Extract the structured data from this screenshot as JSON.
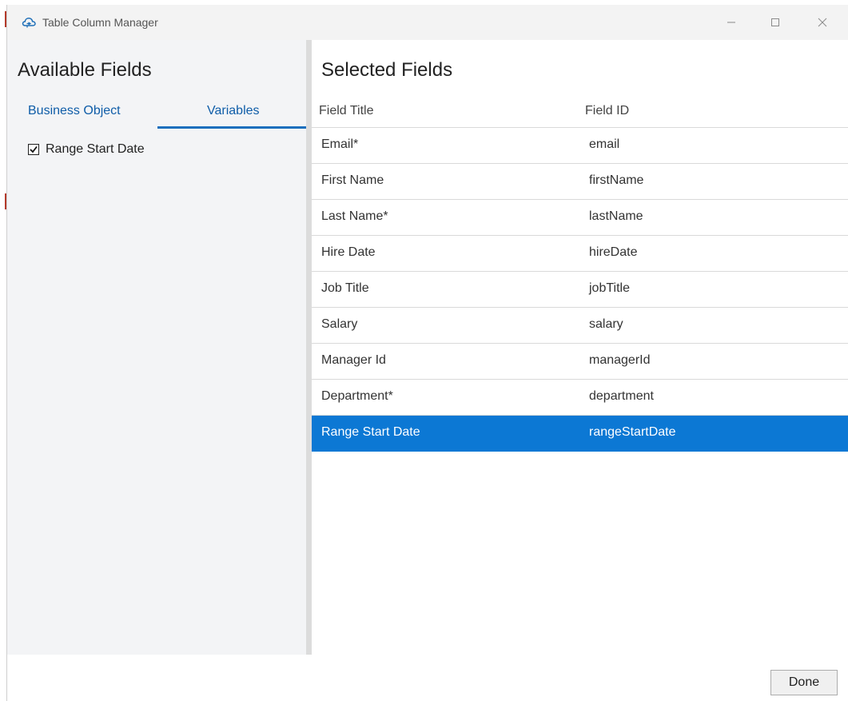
{
  "window": {
    "title": "Table Column Manager",
    "icon": "cloud-logo-icon",
    "controls": {
      "minimize": "minimize-icon",
      "maximize": "maximize-icon",
      "close": "close-icon"
    }
  },
  "available_fields": {
    "heading": "Available Fields",
    "tabs": [
      {
        "label": "Business Object",
        "active": false
      },
      {
        "label": "Variables",
        "active": true
      }
    ],
    "items": [
      {
        "label": "Range Start Date",
        "checked": true
      }
    ]
  },
  "selected_fields": {
    "heading": "Selected Fields",
    "columns": [
      "Field Title",
      "Field ID"
    ],
    "rows": [
      {
        "title": "Email*",
        "id": "email",
        "selected": false
      },
      {
        "title": "First Name",
        "id": "firstName",
        "selected": false
      },
      {
        "title": "Last Name*",
        "id": "lastName",
        "selected": false
      },
      {
        "title": "Hire Date",
        "id": "hireDate",
        "selected": false
      },
      {
        "title": "Job Title",
        "id": "jobTitle",
        "selected": false
      },
      {
        "title": "Salary",
        "id": "salary",
        "selected": false
      },
      {
        "title": "Manager Id",
        "id": "managerId",
        "selected": false
      },
      {
        "title": "Department*",
        "id": "department",
        "selected": false
      },
      {
        "title": "Range Start Date",
        "id": "rangeStartDate",
        "selected": true
      }
    ]
  },
  "footer": {
    "done_label": "Done"
  },
  "colors": {
    "selection": "#0c78d4",
    "tab_text": "#0f5da8",
    "tab_underline": "#1a6fbd"
  }
}
